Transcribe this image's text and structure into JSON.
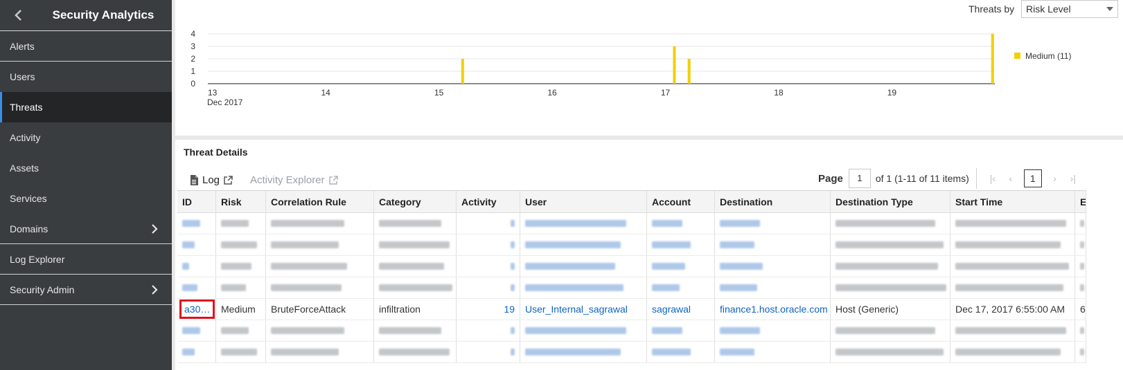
{
  "sidebar": {
    "title": "Security Analytics",
    "items": [
      {
        "label": "Alerts",
        "active": false,
        "chevron": false
      },
      {
        "label": "Users",
        "active": false,
        "chevron": false
      },
      {
        "label": "Threats",
        "active": true,
        "chevron": false
      },
      {
        "label": "Activity",
        "active": false,
        "chevron": false
      },
      {
        "label": "Assets",
        "active": false,
        "chevron": false
      },
      {
        "label": "Services",
        "active": false,
        "chevron": false
      },
      {
        "label": "Domains",
        "active": false,
        "chevron": true
      },
      {
        "label": "Log Explorer",
        "active": false,
        "chevron": false
      },
      {
        "label": "Security Admin",
        "active": false,
        "chevron": true
      }
    ]
  },
  "chart_panel": {
    "threats_by_label": "Threats by",
    "threats_by_value": "Risk Level"
  },
  "chart_data": {
    "type": "bar",
    "x_ticks": [
      "13",
      "14",
      "15",
      "16",
      "17",
      "18",
      "19"
    ],
    "x_sub_label": "Dec 2017",
    "xlim": [
      13,
      19.95
    ],
    "ylim": [
      0,
      4
    ],
    "y_ticks": [
      0,
      1,
      2,
      3,
      4
    ],
    "grid": true,
    "legend_position": "right",
    "series": [
      {
        "name": "Medium (11)",
        "color": "#f2cf00",
        "points": [
          {
            "x": 15.25,
            "y": 2
          },
          {
            "x": 17.12,
            "y": 3
          },
          {
            "x": 17.25,
            "y": 2
          },
          {
            "x": 19.93,
            "y": 4
          }
        ]
      }
    ]
  },
  "details": {
    "title": "Threat Details",
    "toolbar": {
      "log_label": "Log",
      "activity_explorer_label": "Activity Explorer"
    },
    "pager": {
      "page_label": "Page",
      "page_value": "1",
      "of_text": "of 1 (1-11 of 11 items)",
      "current_page": "1"
    },
    "columns": [
      "ID",
      "Risk",
      "Correlation Rule",
      "Category",
      "Activity",
      "User",
      "Account",
      "Destination",
      "Destination Type",
      "Start Time",
      "E"
    ],
    "highlighted_row": {
      "id": "a30…",
      "risk": "Medium",
      "rule": "BruteForceAttack",
      "category": "infiltration",
      "activity": "19",
      "user": "User_Internal_sagrawal",
      "account": "sagrawal",
      "destination": "finance1.host.oracle.com",
      "destination_type": "Host (Generic)",
      "start_time": "Dec 17, 2017 6:55:00 AM",
      "end_fragment": "6"
    }
  },
  "colors": {
    "sidebar_bg": "#3a3d40",
    "active_bg": "#232527",
    "accent": "#3a8ee6",
    "link": "#0f63c2",
    "bar": "#f2cf00",
    "highlight_border": "#e0101e"
  }
}
